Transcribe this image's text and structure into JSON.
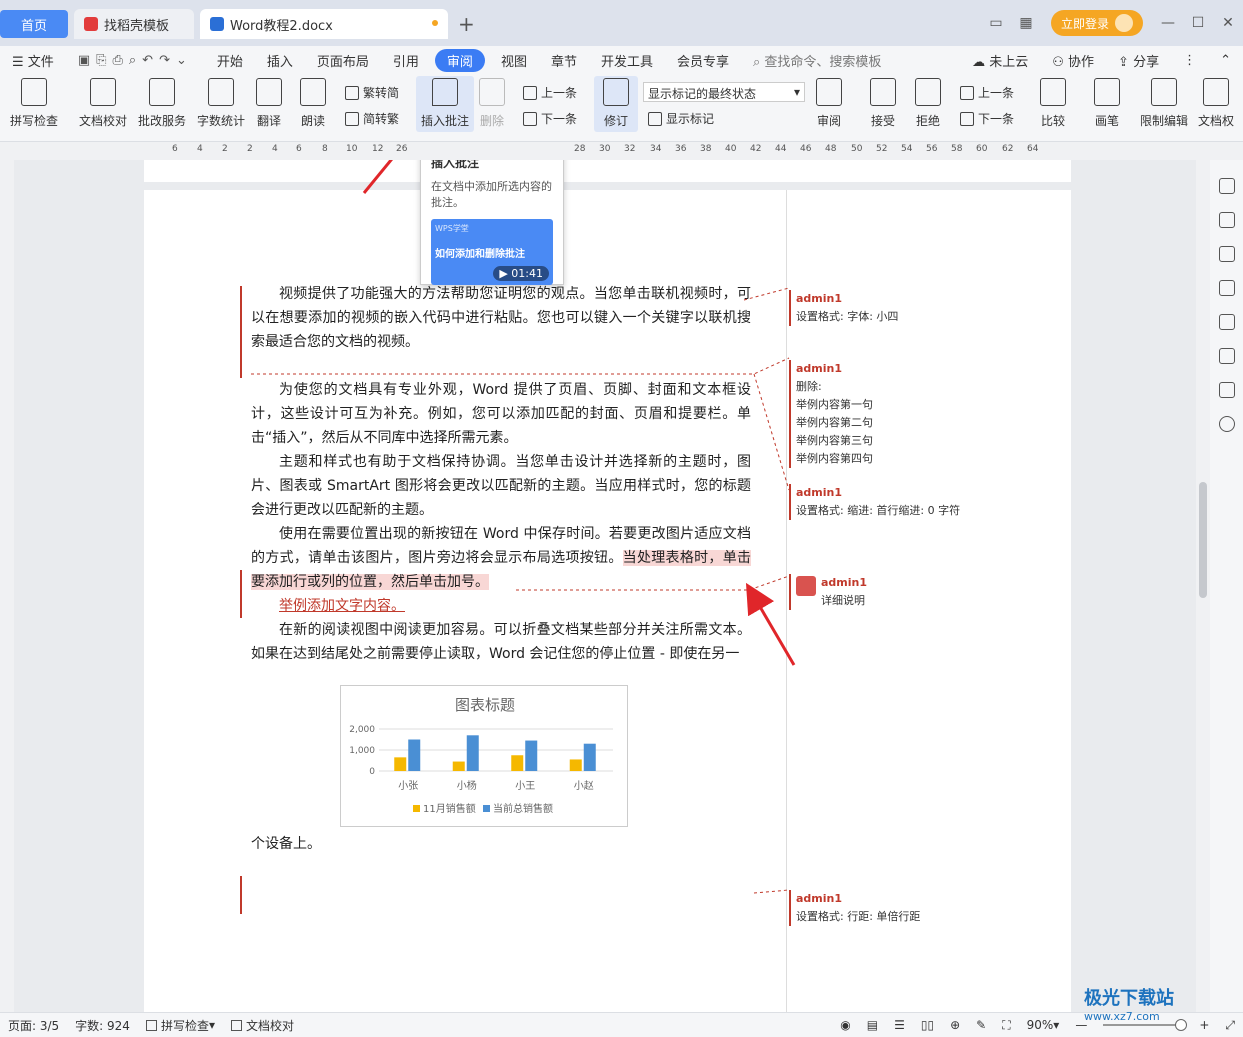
{
  "tabs": {
    "home": "首页",
    "template": "找稻壳模板",
    "doc": "Word教程2.docx",
    "login": "立即登录"
  },
  "menu": {
    "file": "文件",
    "items": [
      "开始",
      "插入",
      "页面布局",
      "引用",
      "审阅",
      "视图",
      "章节",
      "开发工具",
      "会员专享"
    ],
    "search": "查找命令、搜索模板",
    "cloud": "未上云",
    "collab": "协作",
    "share": "分享"
  },
  "ribbon": {
    "spell": "拼写检查",
    "proof": "文档校对",
    "batch": "批改服务",
    "count": "字数统计",
    "translate": "翻译",
    "read": "朗读",
    "t2s": "繁转简",
    "s2t": "简转繁",
    "insert_comment": "插入批注",
    "delete": "删除",
    "prev": "上一条",
    "next": "下一条",
    "revise": "修订",
    "show_state": "显示标记的最终状态",
    "show_marks": "显示标记",
    "review": "审阅",
    "accept": "接受",
    "reject": "拒绝",
    "prev2": "上一条",
    "next2": "下一条",
    "compare": "比较",
    "pen": "画笔",
    "restrict": "限制编辑",
    "docperm": "文档权"
  },
  "ruler": [
    "6",
    "4",
    "2",
    "2",
    "4",
    "6",
    "8",
    "10",
    "12",
    "26",
    "28",
    "30",
    "32",
    "34",
    "36",
    "38",
    "40",
    "42",
    "44",
    "46",
    "48",
    "50",
    "52",
    "54",
    "56",
    "58",
    "60",
    "62",
    "64"
  ],
  "tooltip": {
    "title": "插入批注",
    "desc": "在文档中添加所选内容的批注。",
    "video_brand": "WPS学堂",
    "video_title": "如何添加和删除批注",
    "duration": "01:41"
  },
  "document": {
    "p1": "视频提供了功能强大的方法帮助您证明您的观点。当您单击联机视频时，可以在想要添加的视频的嵌入代码中进行粘贴。您也可以键入一个关键字以联机搜索最适合您的文档的视频。",
    "p2": "为使您的文档具有专业外观，Word 提供了页眉、页脚、封面和文本框设计，这些设计可互为补充。例如，您可以添加匹配的封面、页眉和提要栏。单击“插入”，然后从不同库中选择所需元素。",
    "p3": "主题和样式也有助于文档保持协调。当您单击设计并选择新的主题时，图片、图表或 SmartArt 图形将会更改以匹配新的主题。当应用样式时，您的标题会进行更改以匹配新的主题。",
    "p4a": "使用在需要位置出现的新按钮在 Word 中保存时间。若要更改图片适应文档的方式，请单击该图片，图片旁边将会显示布局选项按钮。",
    "p4b": "当处理表格时，单击要添加行或列的位置，然后单击加号。",
    "p5": "举例添加文字内容。",
    "p6": "在新的阅读视图中阅读更加容易。可以折叠文档某些部分并关注所需文本。如果在达到结尾处之前需要停止读取，Word 会记住您的停止位置 - 即使在另一",
    "p7": "个设备上。"
  },
  "comments": [
    {
      "author": "admin1",
      "lines": [
        "设置格式: 字体: 小四"
      ]
    },
    {
      "author": "admin1",
      "lines": [
        "删除:",
        "举例内容第一句",
        "举例内容第二句",
        "举例内容第三句",
        "举例内容第四句"
      ]
    },
    {
      "author": "admin1",
      "lines": [
        "设置格式: 缩进: 首行缩进: 0 字符"
      ]
    },
    {
      "author": "admin1",
      "lines": [
        "详细说明"
      ]
    },
    {
      "author": "admin1",
      "lines": [
        "设置格式: 行距: 单倍行距"
      ]
    }
  ],
  "chart_data": {
    "type": "bar",
    "title": "图表标题",
    "categories": [
      "小张",
      "小杨",
      "小王",
      "小赵"
    ],
    "series": [
      {
        "name": "11月销售额",
        "values": [
          650,
          450,
          750,
          550
        ],
        "color": "#f5b800"
      },
      {
        "name": "当前总销售额",
        "values": [
          1500,
          1700,
          1450,
          1300
        ],
        "color": "#4a8fd4"
      }
    ],
    "ylim": [
      0,
      2000
    ],
    "yticks": [
      "2,000",
      "1,000",
      "0"
    ],
    "legend": "bottom"
  },
  "status": {
    "page": "页面: 3/5",
    "words": "字数: 924",
    "spell": "拼写检查",
    "proof": "文档校对",
    "zoom": "90%"
  },
  "watermark": {
    "name": "极光下载站",
    "url": "www.xz7.com"
  }
}
